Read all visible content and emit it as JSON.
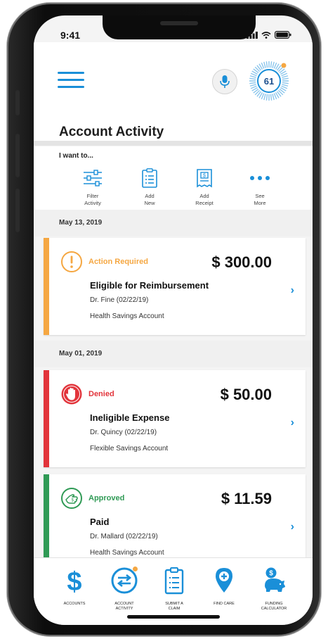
{
  "status_bar": {
    "time": "9:41"
  },
  "header": {
    "score": "61",
    "title": "Account Activity"
  },
  "quick_actions": {
    "heading": "I want to...",
    "items": [
      {
        "line1": "Filter",
        "line2": "Activity",
        "icon": "filter-icon"
      },
      {
        "line1": "Add",
        "line2": "New",
        "icon": "clipboard-icon"
      },
      {
        "line1": "Add",
        "line2": "Receipt",
        "icon": "receipt-icon"
      },
      {
        "line1": "See",
        "line2": "More",
        "icon": "more-dots-icon"
      }
    ]
  },
  "groups": [
    {
      "date": "May 13, 2019",
      "transactions": [
        {
          "status": "Action Required",
          "amount": "$ 300.00",
          "title": "Eligible for Reimbursement",
          "doctor": "Dr. Fine (02/22/19)",
          "account": "Health Savings Account",
          "color": "#f5a742"
        }
      ]
    },
    {
      "date": "May 01, 2019",
      "transactions": [
        {
          "status": "Denied",
          "amount": "$ 50.00",
          "title": "Ineligible Expense",
          "doctor": "Dr. Quincy (02/22/19)",
          "account": "Flexible Savings Account",
          "color": "#e2343b"
        },
        {
          "status": "Approved",
          "amount": "$ 11.59",
          "title": "Paid",
          "doctor": "Dr. Mallard (02/22/19)",
          "account": "Health Savings Account",
          "color": "#2f9a55"
        }
      ]
    }
  ],
  "bottom_nav": [
    {
      "line1": "ACCOUNTS",
      "line2": "",
      "icon": "dollar-icon"
    },
    {
      "line1": "ACCOUNT",
      "line2": "ACTIVITY",
      "icon": "activity-icon"
    },
    {
      "line1": "SUBMIT A",
      "line2": "CLAIM",
      "icon": "clipboard-icon"
    },
    {
      "line1": "FIND CARE",
      "line2": "",
      "icon": "location-pin-icon"
    },
    {
      "line1": "FUNDING",
      "line2": "CALCULATOR",
      "icon": "piggy-bank-icon"
    }
  ],
  "colors": {
    "accent": "#1a8fd8",
    "warning": "#f5a742",
    "danger": "#e2343b",
    "success": "#2f9a55"
  }
}
